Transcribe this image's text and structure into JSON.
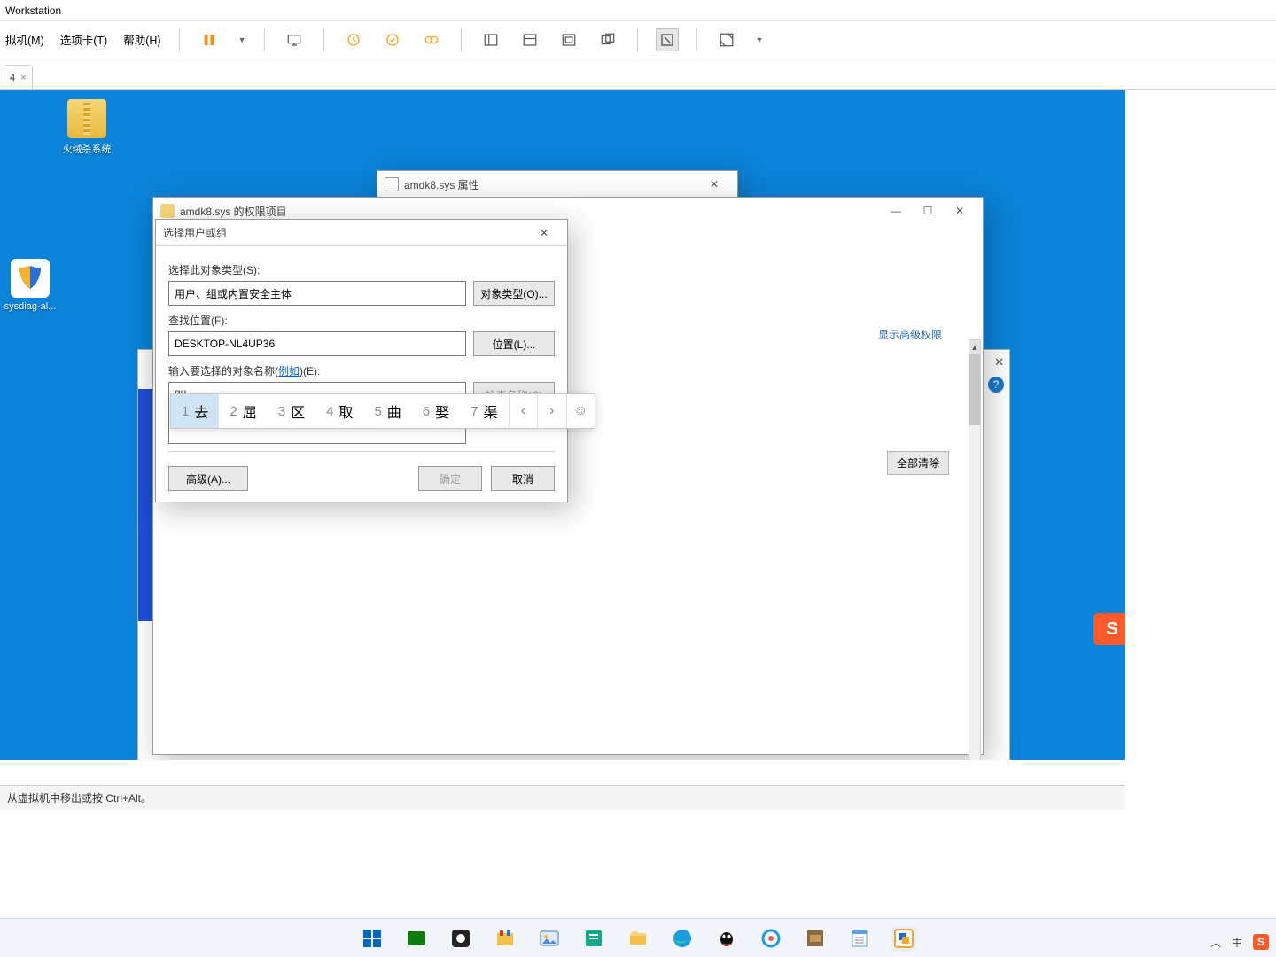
{
  "host": {
    "title": "Workstation",
    "menus": {
      "vm": "拟机(M)",
      "tabs": "选项卡(T)",
      "help": "帮助(H)"
    },
    "tab": {
      "label": "4",
      "close": "×"
    },
    "status": "从虚拟机中移出或按 Ctrl+Alt。"
  },
  "desktop": {
    "icon1": "火绒杀系统",
    "icon2": "sysdiag-al..."
  },
  "props_window": {
    "title": "amdk8.sys 属性"
  },
  "perm_window": {
    "title": "amdk8.sys 的权限项目",
    "show_advanced": "显示高级权限",
    "clear_all": "全部清除"
  },
  "select_dialog": {
    "title": "选择用户或组",
    "object_type_label": "选择此对象类型(S):",
    "object_type_value": "用户、组或内置安全主体",
    "object_type_btn": "对象类型(O)...",
    "location_label": "查找位置(F):",
    "location_value": "DESKTOP-NL4UP36",
    "location_btn": "位置(L)...",
    "name_label_prefix": "输入要选择的对象名称(",
    "name_label_link": "例如",
    "name_label_suffix": ")(E):",
    "name_value": "qu",
    "check_btn": "检查名称(C)",
    "advanced_btn": "高级(A)...",
    "ok_btn": "确定",
    "cancel_btn": "取消"
  },
  "ime": {
    "candidates": [
      {
        "n": "1",
        "ch": "去"
      },
      {
        "n": "2",
        "ch": "屈"
      },
      {
        "n": "3",
        "ch": "区"
      },
      {
        "n": "4",
        "ch": "取"
      },
      {
        "n": "5",
        "ch": "曲"
      },
      {
        "n": "6",
        "ch": "娶"
      },
      {
        "n": "7",
        "ch": "渠"
      }
    ]
  },
  "tray": {
    "ime_lang": "中"
  }
}
